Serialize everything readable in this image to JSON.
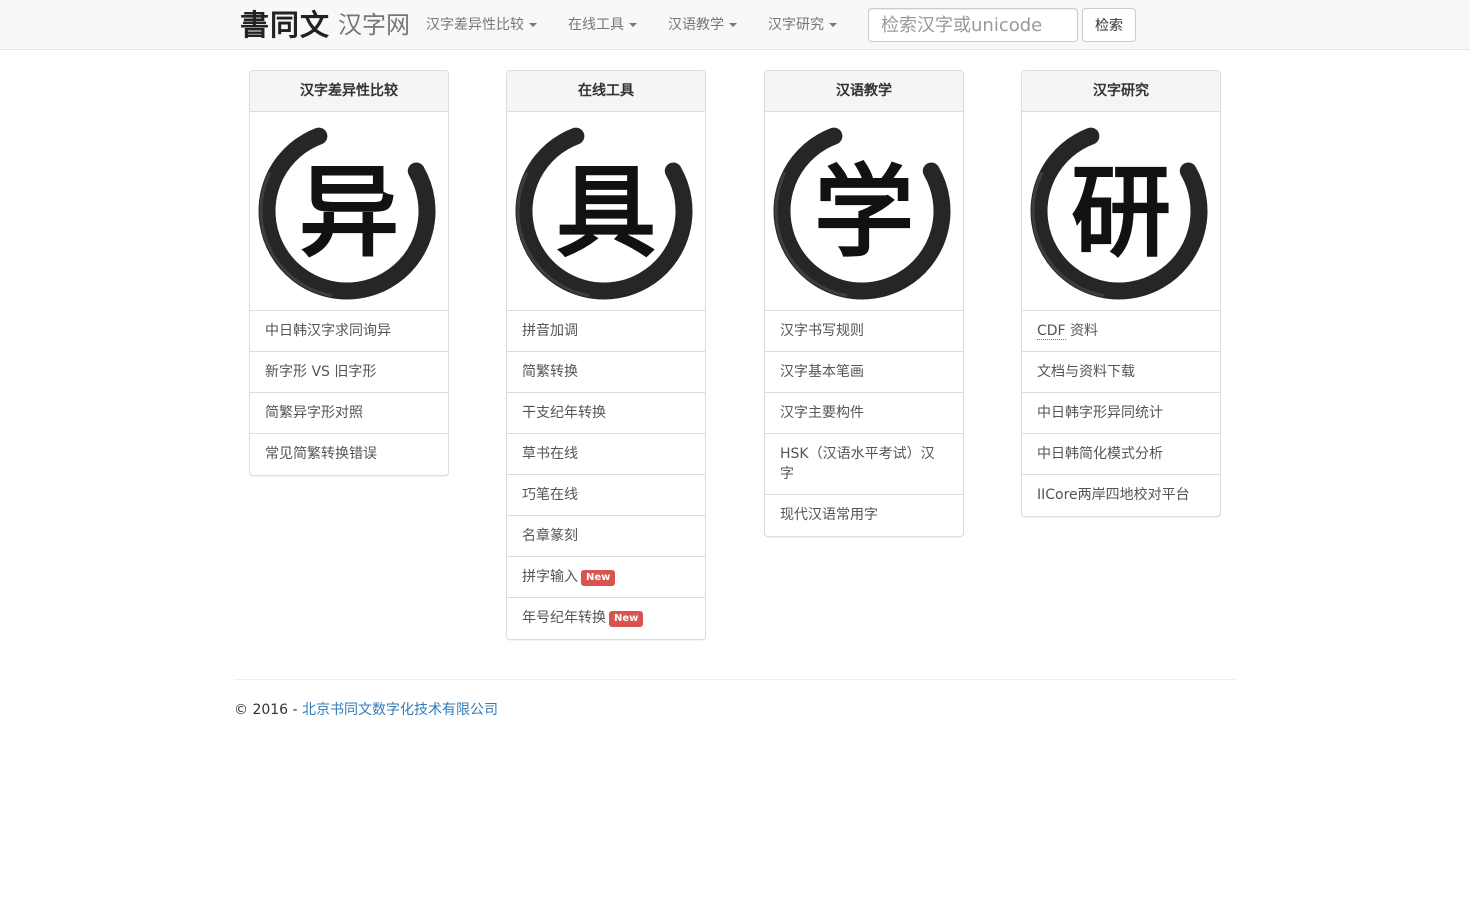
{
  "header": {
    "logo_text": "書同文",
    "site_name": "汉字网",
    "nav": [
      {
        "label": "汉字差异性比较"
      },
      {
        "label": "在线工具"
      },
      {
        "label": "汉语教学"
      },
      {
        "label": "汉字研究"
      }
    ],
    "search": {
      "placeholder": "检索汉字或unicode",
      "button_label": "检索"
    }
  },
  "panels": [
    {
      "title": "汉字差异性比较",
      "emblem_char": "异",
      "items": [
        {
          "label": "中日韩汉字求同询异"
        },
        {
          "label": "新字形 VS 旧字形"
        },
        {
          "label": "简繁异字形对照"
        },
        {
          "label": "常见简繁转换错误"
        }
      ]
    },
    {
      "title": "在线工具",
      "emblem_char": "具",
      "items": [
        {
          "label": "拼音加调"
        },
        {
          "label": "简繁转换"
        },
        {
          "label": "干支纪年转换"
        },
        {
          "label": "草书在线"
        },
        {
          "label": "巧笔在线"
        },
        {
          "label": "名章篆刻"
        },
        {
          "label": "拼字输入",
          "badge": "New"
        },
        {
          "label": "年号纪年转换",
          "badge": "New"
        }
      ]
    },
    {
      "title": "汉语教学",
      "emblem_char": "学",
      "items": [
        {
          "label": "汉字书写规则"
        },
        {
          "label": "汉字基本笔画"
        },
        {
          "label": "汉字主要构件"
        },
        {
          "label": "HSK（汉语水平考试）汉字"
        },
        {
          "label": "现代汉语常用字"
        }
      ]
    },
    {
      "title": "汉字研究",
      "emblem_char": "研",
      "items": [
        {
          "abbr": "CDF",
          "label": " 资料"
        },
        {
          "label": "文档与资料下载"
        },
        {
          "label": "中日韩字形异同统计"
        },
        {
          "label": "中日韩简化模式分析"
        },
        {
          "label": "IICore两岸四地校对平台"
        }
      ]
    }
  ],
  "footer": {
    "copyright": "© 2016 - ",
    "company_link": "北京书同文数字化技术有限公司"
  },
  "colors": {
    "navbar_bg": "#f8f8f8",
    "link": "#337ab7",
    "badge_new": "#d9534f",
    "border": "#dddddd"
  }
}
